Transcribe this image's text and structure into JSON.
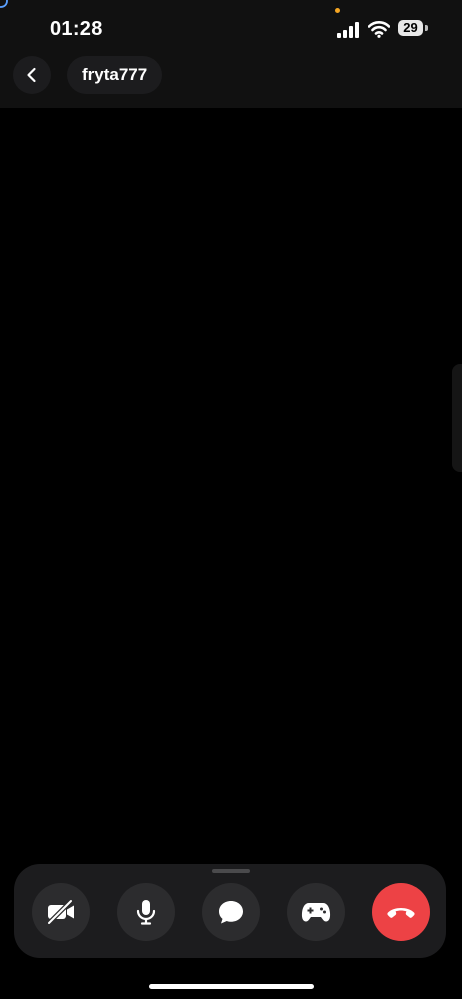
{
  "status_bar": {
    "time": "01:28",
    "battery_level": "29",
    "icons": [
      "corner-glyph",
      "privacy-dot",
      "cellular-signal-icon",
      "wifi-icon",
      "battery-icon"
    ],
    "privacy_dot_color": "#f5a623"
  },
  "header": {
    "back_icon": "chevron-left-icon",
    "username": "fryta777"
  },
  "controls": {
    "buttons": [
      {
        "name": "toggle-camera-button",
        "icon": "video-off-icon"
      },
      {
        "name": "microphone-button",
        "icon": "microphone-icon"
      },
      {
        "name": "chat-button",
        "icon": "chat-bubble-icon"
      },
      {
        "name": "activities-button",
        "icon": "gamepad-icon"
      },
      {
        "name": "end-call-button",
        "icon": "phone-hangup-icon",
        "color": "#ed4245"
      }
    ]
  },
  "colors": {
    "background": "#000000",
    "bar_background": "#111111",
    "panel_background": "#1c1c1e",
    "button_background": "#2c2c2e",
    "end_call": "#ed4245"
  }
}
